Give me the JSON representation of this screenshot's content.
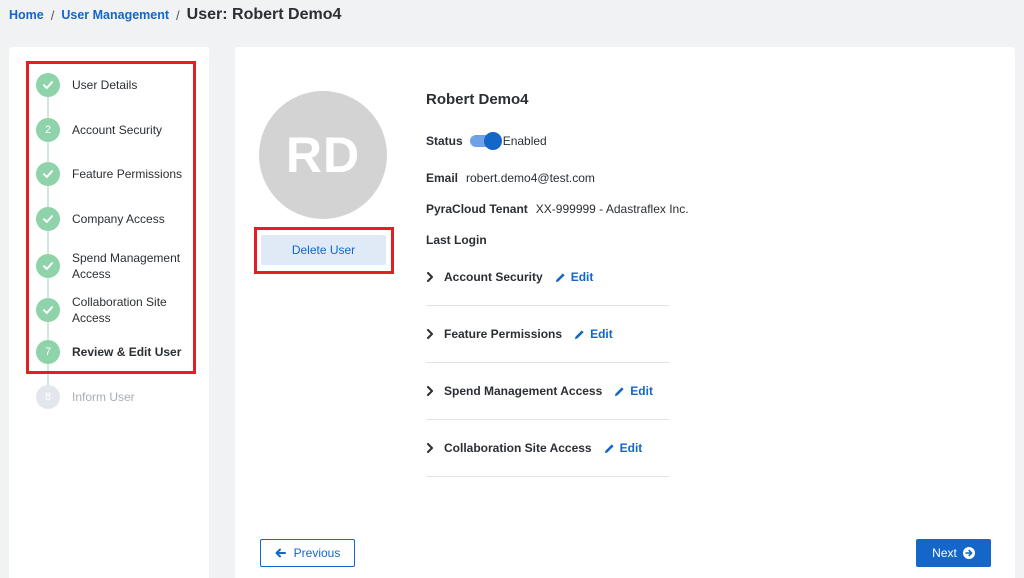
{
  "breadcrumb": {
    "home": "Home",
    "user_management": "User Management",
    "current": "User: Robert Demo4"
  },
  "steps": [
    {
      "number": "1",
      "label": "User Details",
      "state": "complete"
    },
    {
      "number": "2",
      "label": "Account Security",
      "state": "numbered"
    },
    {
      "number": "3",
      "label": "Feature Permissions",
      "state": "complete"
    },
    {
      "number": "4",
      "label": "Company Access",
      "state": "complete"
    },
    {
      "number": "5",
      "label": "Spend Management Access",
      "state": "complete"
    },
    {
      "number": "6",
      "label": "Collaboration Site Access",
      "state": "complete"
    },
    {
      "number": "7",
      "label": "Review & Edit User",
      "state": "active"
    },
    {
      "number": "8",
      "label": "Inform User",
      "state": "pending"
    }
  ],
  "user": {
    "initials": "RD",
    "name": "Robert Demo4",
    "delete_label": "Delete User",
    "status_label": "Status",
    "status_value": "Enabled",
    "email_label": "Email",
    "email_value": "robert.demo4@test.com",
    "tenant_label": "PyraCloud Tenant",
    "tenant_value": "XX-999999 - Adastraflex Inc.",
    "last_login_label": "Last Login"
  },
  "sections": [
    {
      "title": "Account Security",
      "edit_label": "Edit"
    },
    {
      "title": "Feature Permissions",
      "edit_label": "Edit"
    },
    {
      "title": "Spend Management Access",
      "edit_label": "Edit"
    },
    {
      "title": "Collaboration Site Access",
      "edit_label": "Edit"
    }
  ],
  "nav": {
    "previous_label": "Previous",
    "next_label": "Next"
  },
  "colors": {
    "accent": "#1466c8",
    "step_complete": "#8fd3ab",
    "highlight": "#e31e24"
  }
}
